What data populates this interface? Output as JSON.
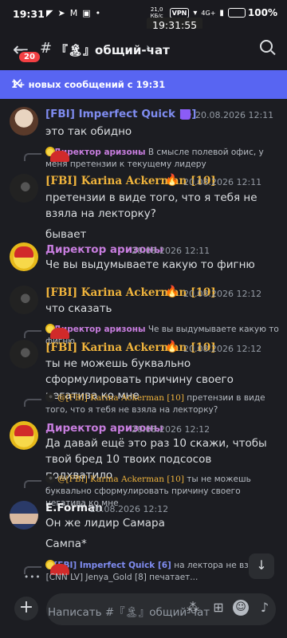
{
  "status": {
    "time": "19:31",
    "clock_popup": "19:31:55",
    "net_speed": "21,0 КБ/с",
    "vpn": "VPN",
    "network": "4G+",
    "battery": "100%"
  },
  "header": {
    "unread_badge": "20",
    "hash": "#",
    "channel": "『🏝』общий-чат"
  },
  "banner": {
    "text": "1+ новых сообщений с 19:31"
  },
  "messages": [
    {
      "author": "[FBI] Imperfect Quick [6]",
      "time": "20.08.2026 12:11",
      "text": "это так обидно"
    },
    {
      "reply_to": "@Директор аризоны",
      "reply_text": "В смысле полевой офис, у меня претензии к текущему лидеру",
      "author": "[FBI] Karina Ackerman [10]",
      "time": "20.08.2026 12:11",
      "text": "претензии в виде того, что я тебя не взяла на лекторку?",
      "text2": "бывает"
    },
    {
      "author": "Директор аризоны",
      "time": "20.08.2026 12:11",
      "text": "Че вы выдумываете какую то фигню"
    },
    {
      "author": "[FBI] Karina Ackerman [10]",
      "time": "20.08.2026 12:12",
      "text": "что сказать"
    },
    {
      "reply_to": "@Директор аризоны",
      "reply_text": "Че вы выдумываете какую то фигню",
      "author": "[FBI] Karina Ackerman [10]",
      "time": "20.08.2026 12:12",
      "text": "ты не можешь буквально сформулировать причину своего негатива ко мне"
    },
    {
      "reply_to": "@[FBI] Karina Ackerman [10]",
      "reply_text": "претензии в виде того, что я тебя не взяла на лекторку?",
      "author": "Директор аризоны",
      "time": "20.08.2026 12:12",
      "text": "Да давай ещё это раз 10 скажи, чтобы твой бред 10 твоих подсосов подхватило"
    },
    {
      "reply_to": "@[FBI] Karina Ackerman [10]",
      "reply_text": "ты не можешь буквально сформулировать причину своего негатива ко мне",
      "author": "E.Forman",
      "time": "20.08.2026 12:12",
      "text": "Он же лидир Самара",
      "text2": "Сампа*"
    },
    {
      "reply_to": "@[FBI] Imperfect Quick [6]",
      "reply_text": "на лектора не взяли"
    }
  ],
  "typing": "[CNN LV] Jenya_Gold [8] печатает...",
  "composer": {
    "placeholder": "Написать #『🏝』общий-чат"
  },
  "icons": [
    "back-arrow-icon",
    "search-icon",
    "close-icon",
    "plus-icon",
    "gift-icon",
    "emoji-icon",
    "mic-icon",
    "apps-icon",
    "arrow-down-icon",
    "fire-emoji"
  ]
}
